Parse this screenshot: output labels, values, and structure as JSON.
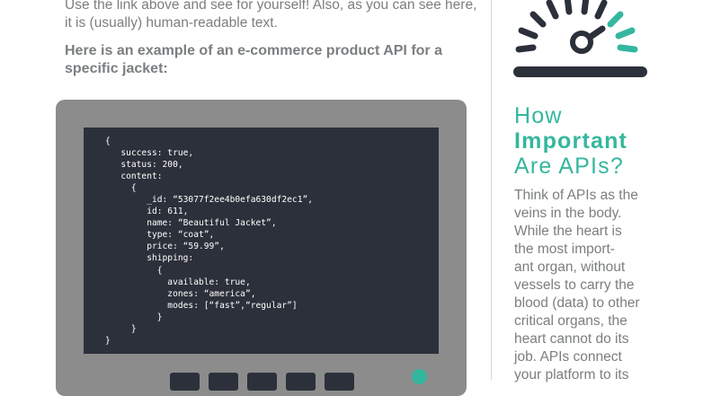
{
  "intro": {
    "line1": "Use the link above and see for yourself! Also, as you can see here,",
    "line2": "it is (usually) human-readable text."
  },
  "example_heading": {
    "line1": "Here is an example of an e-commerce product API for a",
    "line2": "specific jacket:"
  },
  "code_sample": "{\n   success: true,\n   status: 200,\n   content:\n     {\n        _id: “53077f2ee4b0efa630df2ec1”,\n        id: 611,\n        name: “Beautiful Jacket”,\n        type: “coat”,\n        price: “59.99”,\n        shipping:\n          {\n            available: true,\n            zones: “america”,\n            modes: [“fast”,“regular”]\n          }\n     }\n}",
  "sidebar": {
    "heading": {
      "line1": "How",
      "line2": "Important",
      "line3": "Are APIs?"
    },
    "body_lines": [
      "Think of APIs as the",
      "veins in the body.",
      "While the heart is",
      "the most import-",
      "ant organ, without",
      "vessels to carry the",
      "blood (data) to other",
      "critical organs, the",
      "heart cannot do its",
      "job. APIs connect",
      "your platform to its"
    ]
  },
  "colors": {
    "accent": "#35b79f",
    "dark": "#2c303a",
    "device_gray": "#8c8c8c",
    "text_gray": "#7b7e80"
  }
}
